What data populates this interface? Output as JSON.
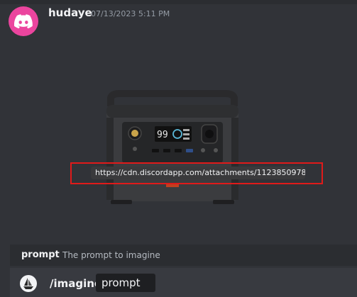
{
  "message": {
    "username": "hudaye",
    "timestamp": "07/13/2023 5:11 PM",
    "avatar_icon": "discord-logo-icon",
    "avatar_color": "#eb459e",
    "attachment": {
      "image": "power-station-image",
      "url_text": "https://cdn.discordapp.com/attachments/1123850978…"
    },
    "highlight_color": "#e01a1a"
  },
  "command_hint": {
    "option_name": "prompt",
    "option_description": "The prompt to imagine"
  },
  "composer": {
    "bot_avatar_icon": "sailboat-icon",
    "command": "/imagine",
    "parameter": "prompt"
  }
}
